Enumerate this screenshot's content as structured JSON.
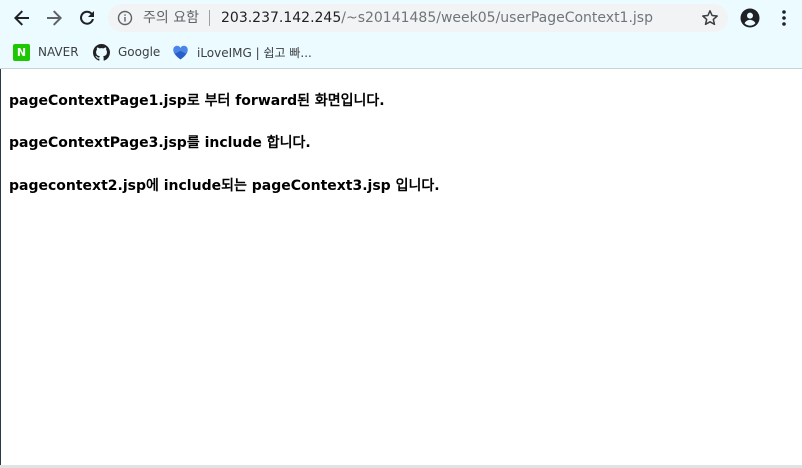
{
  "browser": {
    "security_label": "주의 요함",
    "url_host": "203.237.142.245",
    "url_path": "/~s20141485/week05/userPageContext1.jsp"
  },
  "bookmarks": [
    {
      "label": "NAVER",
      "icon": "naver-icon"
    },
    {
      "label": "Google",
      "icon": "github-icon"
    },
    {
      "label": "iLoveIMG | 쉽고 빠...",
      "icon": "ilovemig-heart-icon"
    }
  ],
  "page": {
    "lines": [
      "pageContextPage1.jsp로 부터 forward된 화면입니다.",
      "pageContextPage3.jsp를 include 합니다.",
      "pagecontext2.jsp에 include되는 pageContext3.jsp 입니다."
    ]
  },
  "colors": {
    "toolbar_bg": "#ecfbff",
    "omnibox_bg": "#f1f3f4",
    "naver_green": "#1ec800",
    "ilovemig_blue": "#4a86e8"
  }
}
